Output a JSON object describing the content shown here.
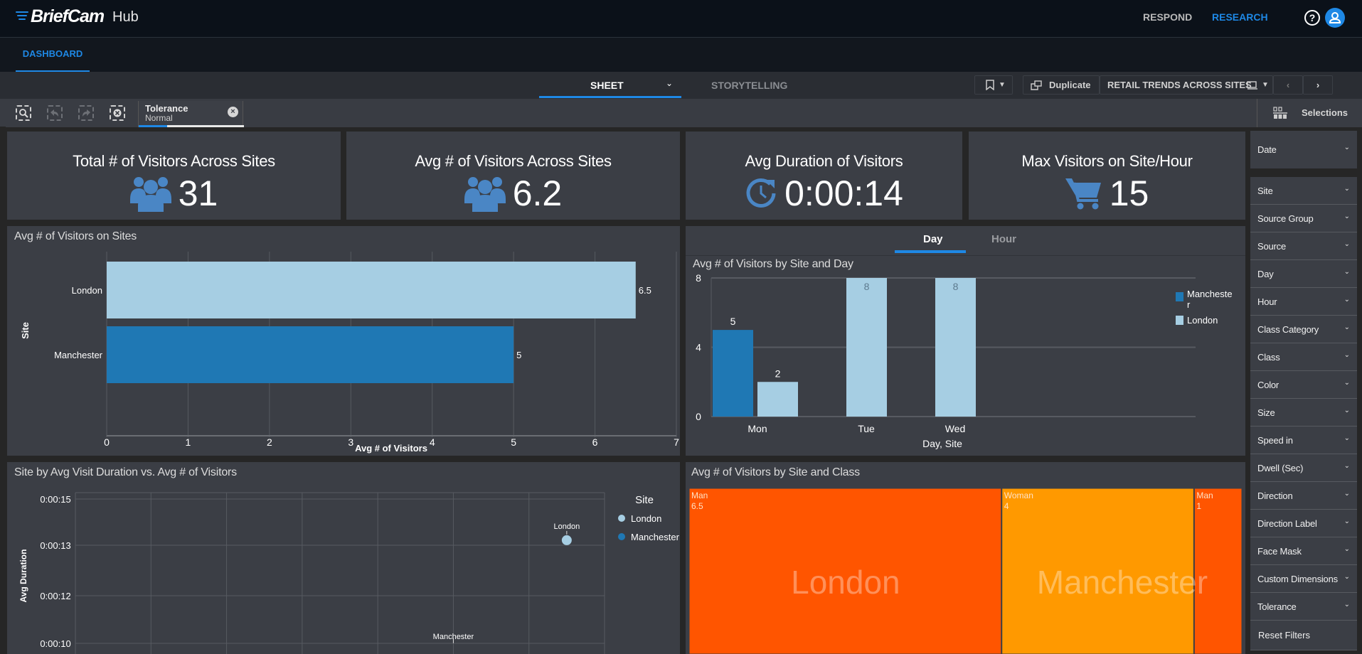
{
  "app": {
    "brand": "BriefCam",
    "product": "Hub",
    "nav": [
      {
        "label": "RESPOND",
        "active": false
      },
      {
        "label": "RESEARCH",
        "active": true
      }
    ],
    "help_icon": "question-circle-icon",
    "user_icon": "user-icon",
    "accent_color": "#1e88e5"
  },
  "tabs": {
    "dashboard": "DASHBOARD"
  },
  "sheetbar": {
    "sheet_label": "SHEET",
    "storytelling_label": "STORYTELLING",
    "duplicate_label": "Duplicate",
    "sheet_title": "RETAIL TRENDS ACROSS SITES",
    "prev_icon": "‹",
    "next_icon": "›"
  },
  "toolbar": {
    "tools": [
      "smart-search-icon",
      "step-back-icon",
      "step-forward-icon",
      "clear-selections-icon"
    ],
    "active_selection": {
      "field": "Tolerance",
      "value": "Normal",
      "progress": 0.27
    },
    "selections_label": "Selections"
  },
  "kpis": [
    {
      "title": "Total # of Visitors Across Sites",
      "value": "31",
      "icon": "people-icon"
    },
    {
      "title": "Avg # of Visitors Across Sites",
      "value": "6.2",
      "icon": "people-icon"
    },
    {
      "title": "Avg Duration of Visitors",
      "value": "0:00:14",
      "icon": "clock-refresh-icon"
    },
    {
      "title": "Max Visitors on Site/Hour",
      "value": "15",
      "icon": "cart-icon"
    }
  ],
  "day_hour_tabs": [
    {
      "label": "Day",
      "active": true
    },
    {
      "label": "Hour",
      "active": false
    }
  ],
  "filters": {
    "date": "Date",
    "items": [
      "Site",
      "Source Group",
      "Source",
      "Day",
      "Hour",
      "Class Category",
      "Class",
      "Color",
      "Size",
      "Speed in",
      "Dwell (Sec)",
      "Direction",
      "Direction Label",
      "Face Mask",
      "Custom Dimensions",
      "Tolerance"
    ],
    "reset_label": "Reset Filters"
  },
  "colors": {
    "london": "#a6cee3",
    "manchester": "#1f78b4",
    "treemap_man": "#ff5500",
    "treemap_woman": "#ff9900"
  },
  "chart_data": [
    {
      "id": "visitors_on_sites",
      "type": "bar",
      "orientation": "horizontal",
      "title": "Avg # of Visitors on Sites",
      "categories": [
        "London",
        "Manchester"
      ],
      "values": [
        6.5,
        5
      ],
      "data_labels": [
        "6.5",
        "5"
      ],
      "xlabel": "Avg # of Visitors",
      "ylabel": "Site",
      "xlim": [
        0,
        7
      ],
      "xticks": [
        "0",
        "1",
        "2",
        "3",
        "4",
        "5",
        "6",
        "7"
      ],
      "grid": true
    },
    {
      "id": "visitors_by_site_day",
      "type": "bar",
      "title": "Avg # of Visitors by Site and Day",
      "categories": [
        "Mon",
        "Tue",
        "Wed"
      ],
      "series": [
        {
          "name": "Manchester",
          "values": [
            5,
            null,
            null
          ]
        },
        {
          "name": "London",
          "values": [
            2,
            8,
            8
          ]
        }
      ],
      "legend_labels": [
        "Mancheste r",
        "London"
      ],
      "xlabel": "Day, Site",
      "ylabel": "",
      "ylim": [
        0,
        8
      ],
      "yticks": [
        "0",
        "4",
        "8"
      ],
      "legend": "right",
      "grid": true
    },
    {
      "id": "duration_vs_visitors",
      "type": "scatter",
      "title": "Site by Avg Visit Duration vs. Avg # of Visitors",
      "xlabel": "",
      "ylabel": "Avg Duration",
      "yticks": [
        "0:00:15",
        "0:00:13",
        "0:00:12",
        "0:00:10"
      ],
      "xlim": [
        0,
        7
      ],
      "points": [
        {
          "label": "London",
          "x": 6.5,
          "y_seconds": 13.1,
          "series": "London"
        },
        {
          "label": "Manchester",
          "x": 5,
          "y_seconds": 11.2,
          "series": "Manchester"
        }
      ],
      "legend_title": "Site",
      "legend": [
        "London",
        "Manchester"
      ],
      "grid": true
    },
    {
      "id": "visitors_by_site_class",
      "type": "treemap",
      "title": "Avg # of Visitors by Site and Class",
      "groups": [
        {
          "name": "London",
          "children": [
            {
              "label": "Man",
              "value": 6.5
            }
          ]
        },
        {
          "name": "Manchester",
          "children": [
            {
              "label": "Woman",
              "value": 4
            },
            {
              "label": "Man",
              "value": 1
            }
          ]
        }
      ]
    }
  ]
}
